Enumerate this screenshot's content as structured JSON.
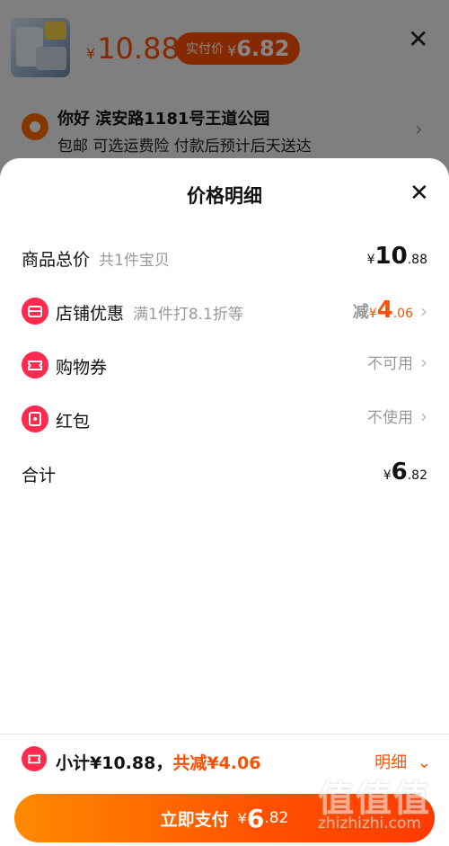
{
  "background": {
    "price_currency": "¥",
    "price": "10.88",
    "actual_label": "实付价",
    "actual_currency": "¥",
    "actual_price": "6.82",
    "close_glyph": "✕",
    "address_title": "你好 滨安路1181号王道公园",
    "address_sub": "包邮 可选运费险 付款后预计后天送达",
    "address_chevron": "›"
  },
  "sheet": {
    "title": "价格明细",
    "close_glyph": "✕",
    "rows": [
      {
        "label": "商品总价",
        "sub": "共1件宝贝",
        "currency": "¥",
        "int": "10",
        "dec": ".88"
      },
      {
        "label": "店铺优惠",
        "sub": "满1件打8.1折等",
        "prefix": "减",
        "currency": "¥",
        "int": "4",
        "dec": ".06",
        "icon": "store-icon"
      },
      {
        "label": "购物券",
        "value": "不可用",
        "icon": "ticket-icon"
      },
      {
        "label": "红包",
        "value": "不使用",
        "icon": "red-envelope-icon"
      },
      {
        "label": "合计",
        "currency": "¥",
        "int": "6",
        "dec": ".82"
      }
    ],
    "chevron": "›"
  },
  "bottom": {
    "subtotal": "小计¥10.88，",
    "saved": "共减¥4.06",
    "detail": "明细",
    "detail_chevron": "⌄",
    "pay_label": "立即支付",
    "pay_currency": "¥",
    "pay_int": "6",
    "pay_dec": ".82"
  },
  "watermark": {
    "big": "值值值",
    "small": "zhizhizhi.com"
  },
  "colors": {
    "accent": "#ff5000",
    "icon_red": "#ff2a4d"
  }
}
